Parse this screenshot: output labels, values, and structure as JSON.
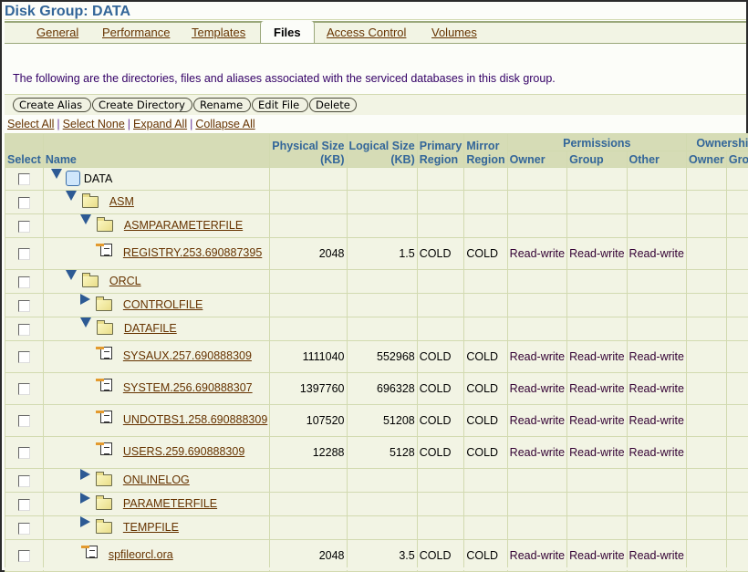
{
  "header": {
    "title": "Disk Group: DATA"
  },
  "tabs": [
    {
      "label": "General",
      "active": false
    },
    {
      "label": "Performance",
      "active": false
    },
    {
      "label": "Templates",
      "active": false
    },
    {
      "label": "Files",
      "active": true
    },
    {
      "label": "Access Control",
      "active": false
    },
    {
      "label": "Volumes",
      "active": false
    }
  ],
  "description": "The following are the directories, files and aliases associated with the serviced databases in this disk group.",
  "toolbar": {
    "buttons": [
      "Create Alias",
      "Create Directory",
      "Rename",
      "Edit File",
      "Delete"
    ]
  },
  "selection_links": [
    "Select All",
    "Select None",
    "Expand All",
    "Collapse All"
  ],
  "table": {
    "headers": {
      "select": "Select",
      "name": "Name",
      "physical_size_1": "Physical Size",
      "physical_size_2": "(KB)",
      "logical_size_1": "Logical  Size",
      "logical_size_2": "(KB)",
      "primary_region_1": "Primary",
      "primary_region_2": "Region",
      "mirror_region_1": "Mirror",
      "mirror_region_2": "Region",
      "permissions": "Permissions",
      "ownership": "Ownership",
      "perm_owner": "Owner",
      "perm_group": "Group",
      "perm_other": "Other",
      "own_owner": "Owner",
      "own_group": "Group"
    },
    "rows": [
      {
        "name": "DATA",
        "type": "diskgroup",
        "level": 0,
        "toggle": "expanded",
        "link": false,
        "physical": "",
        "logical": "",
        "primary": "",
        "mirror": "",
        "p_owner": "",
        "p_group": "",
        "p_other": ""
      },
      {
        "name": "ASM",
        "type": "folder",
        "level": 1,
        "toggle": "expanded",
        "link": true,
        "physical": "",
        "logical": "",
        "primary": "",
        "mirror": "",
        "p_owner": "",
        "p_group": "",
        "p_other": ""
      },
      {
        "name": "ASMPARAMETERFILE",
        "type": "folder",
        "level": 2,
        "toggle": "expanded",
        "link": true,
        "physical": "",
        "logical": "",
        "primary": "",
        "mirror": "",
        "p_owner": "",
        "p_group": "",
        "p_other": ""
      },
      {
        "name": "REGISTRY.253.690887395",
        "type": "file",
        "level": 3,
        "toggle": "none",
        "link": true,
        "physical": "2048",
        "logical": "1.5",
        "primary": "COLD",
        "mirror": "COLD",
        "p_owner": "Read-write",
        "p_group": "Read-write",
        "p_other": "Read-write"
      },
      {
        "name": "ORCL",
        "type": "folder",
        "level": 1,
        "toggle": "expanded",
        "link": true,
        "physical": "",
        "logical": "",
        "primary": "",
        "mirror": "",
        "p_owner": "",
        "p_group": "",
        "p_other": ""
      },
      {
        "name": "CONTROLFILE",
        "type": "folder",
        "level": 2,
        "toggle": "collapsed",
        "link": true,
        "physical": "",
        "logical": "",
        "primary": "",
        "mirror": "",
        "p_owner": "",
        "p_group": "",
        "p_other": ""
      },
      {
        "name": "DATAFILE",
        "type": "folder",
        "level": 2,
        "toggle": "expanded",
        "link": true,
        "physical": "",
        "logical": "",
        "primary": "",
        "mirror": "",
        "p_owner": "",
        "p_group": "",
        "p_other": ""
      },
      {
        "name": "SYSAUX.257.690888309",
        "type": "file",
        "level": 3,
        "toggle": "none",
        "link": true,
        "physical": "1111040",
        "logical": "552968",
        "primary": "COLD",
        "mirror": "COLD",
        "p_owner": "Read-write",
        "p_group": "Read-write",
        "p_other": "Read-write"
      },
      {
        "name": "SYSTEM.256.690888307",
        "type": "file",
        "level": 3,
        "toggle": "none",
        "link": true,
        "physical": "1397760",
        "logical": "696328",
        "primary": "COLD",
        "mirror": "COLD",
        "p_owner": "Read-write",
        "p_group": "Read-write",
        "p_other": "Read-write"
      },
      {
        "name": "UNDOTBS1.258.690888309",
        "type": "file",
        "level": 3,
        "toggle": "none",
        "link": true,
        "physical": "107520",
        "logical": "51208",
        "primary": "COLD",
        "mirror": "COLD",
        "p_owner": "Read-write",
        "p_group": "Read-write",
        "p_other": "Read-write"
      },
      {
        "name": "USERS.259.690888309",
        "type": "file",
        "level": 3,
        "toggle": "none",
        "link": true,
        "physical": "12288",
        "logical": "5128",
        "primary": "COLD",
        "mirror": "COLD",
        "p_owner": "Read-write",
        "p_group": "Read-write",
        "p_other": "Read-write"
      },
      {
        "name": "ONLINELOG",
        "type": "folder",
        "level": 2,
        "toggle": "collapsed",
        "link": true,
        "physical": "",
        "logical": "",
        "primary": "",
        "mirror": "",
        "p_owner": "",
        "p_group": "",
        "p_other": ""
      },
      {
        "name": "PARAMETERFILE",
        "type": "folder",
        "level": 2,
        "toggle": "collapsed",
        "link": true,
        "physical": "",
        "logical": "",
        "primary": "",
        "mirror": "",
        "p_owner": "",
        "p_group": "",
        "p_other": ""
      },
      {
        "name": "TEMPFILE",
        "type": "folder",
        "level": 2,
        "toggle": "collapsed",
        "link": true,
        "physical": "",
        "logical": "",
        "primary": "",
        "mirror": "",
        "p_owner": "",
        "p_group": "",
        "p_other": ""
      },
      {
        "name": "spfileorcl.ora",
        "type": "file",
        "level": 2,
        "toggle": "none",
        "link": true,
        "physical": "2048",
        "logical": "3.5",
        "primary": "COLD",
        "mirror": "COLD",
        "p_owner": "Read-write",
        "p_group": "Read-write",
        "p_other": "Read-write"
      }
    ]
  }
}
